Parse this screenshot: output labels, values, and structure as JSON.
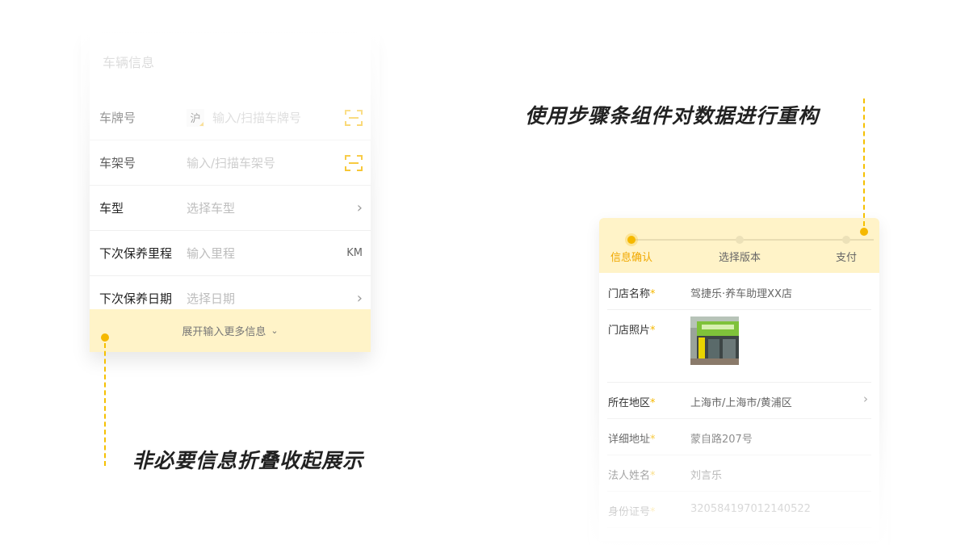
{
  "left": {
    "title": "车辆信息",
    "rows": [
      {
        "label": "车牌号",
        "prefix": "沪",
        "placeholder": "输入/扫描车牌号",
        "right": "scan-icon"
      },
      {
        "label": "车架号",
        "placeholder": "输入/扫描车架号",
        "right": "scan-icon"
      },
      {
        "label": "车型",
        "placeholder": "选择车型",
        "right": "chevron-right-icon"
      },
      {
        "label": "下次保养里程",
        "placeholder": "输入里程",
        "unit": "KM"
      },
      {
        "label": "下次保养日期",
        "placeholder": "选择日期",
        "right": "chevron-right-icon"
      }
    ],
    "expand_label": "展开输入更多信息",
    "caption": "非必要信息折叠收起展示"
  },
  "right": {
    "caption": "使用步骤条组件对数据进行重构",
    "steps": [
      {
        "label": "信息确认",
        "active": true
      },
      {
        "label": "选择版本",
        "active": false
      },
      {
        "label": "支付",
        "active": false
      }
    ],
    "required_mark": "*",
    "fields": [
      {
        "label": "门店名称",
        "value": "驾捷乐·养车助理XX店"
      },
      {
        "label": "门店照片",
        "value": ""
      },
      {
        "label": "所在地区",
        "value": "上海市/上海市/黄浦区"
      },
      {
        "label": "详细地址",
        "value": "蒙自路207号"
      },
      {
        "label": "法人姓名",
        "value": "刘言乐"
      },
      {
        "label": "身份证号",
        "value": "320584197012140522"
      }
    ]
  },
  "colors": {
    "accent": "#f5b800",
    "highlight_bg": "#fff3c8"
  }
}
